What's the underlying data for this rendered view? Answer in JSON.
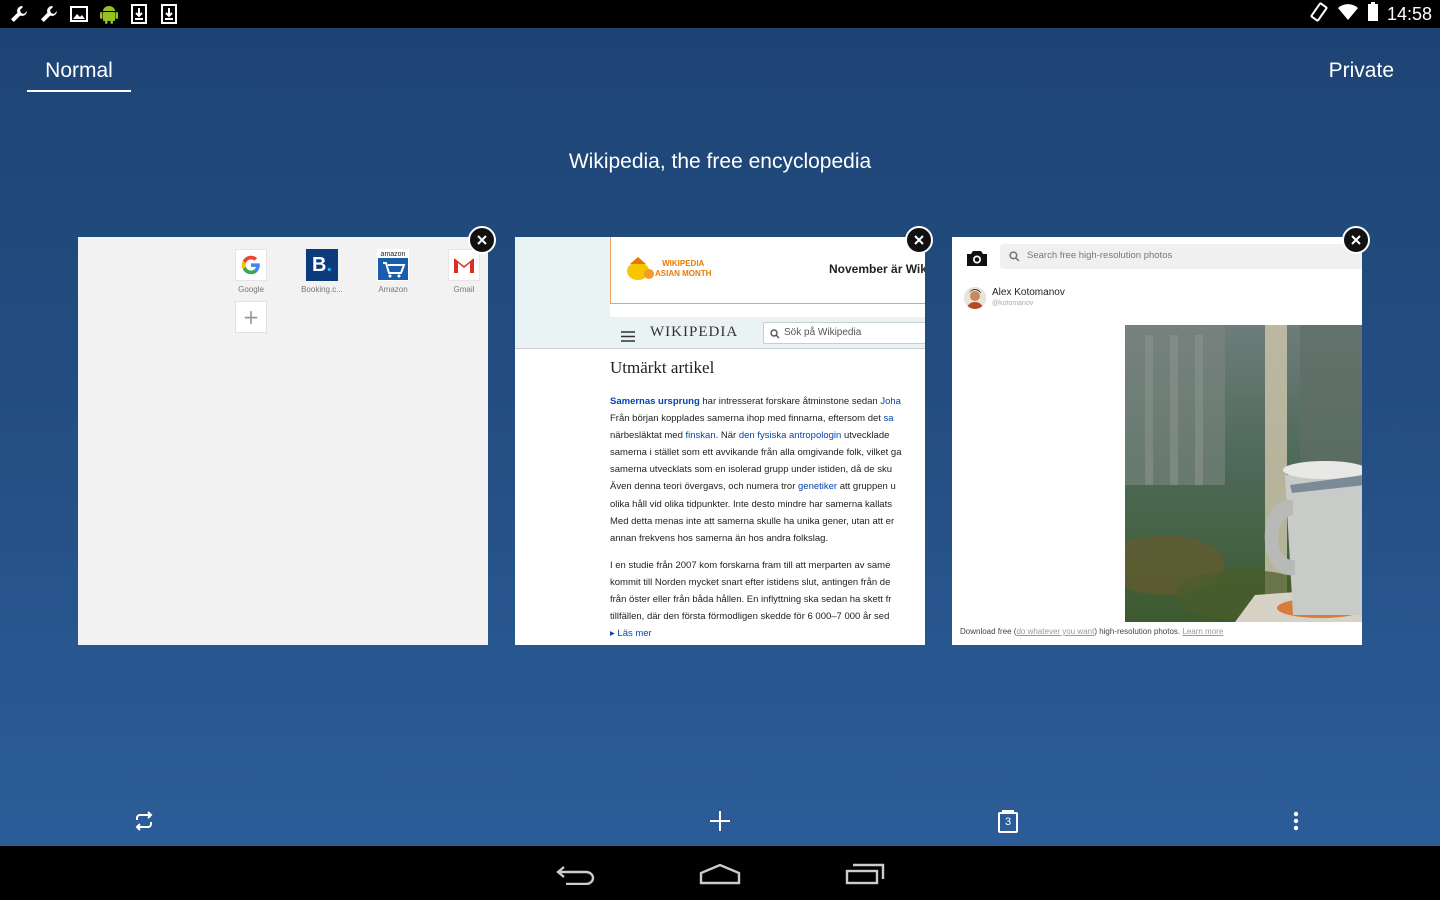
{
  "status_bar": {
    "time": "14:58",
    "left_icons": [
      "wrench-icon",
      "wrench-icon",
      "image-icon",
      "android-icon",
      "download-icon",
      "download-icon"
    ],
    "right_icons": [
      "rotate-icon",
      "wifi-icon",
      "battery-icon"
    ]
  },
  "tabs": {
    "normal": "Normal",
    "private": "Private"
  },
  "current_page_title": "Wikipedia, the free encyclopedia",
  "speed_dial": {
    "items": [
      {
        "label": "Google",
        "icon": "google-icon"
      },
      {
        "label": "Booking.c...",
        "icon": "booking-icon"
      },
      {
        "label": "Amazon",
        "icon": "amazon-icon"
      },
      {
        "label": "Gmail",
        "icon": "gmail-icon"
      }
    ],
    "add_label": "+"
  },
  "wiki_card": {
    "banner_logo_line1": "WIKIPEDIA",
    "banner_logo_line2": "ASIAN MONTH",
    "banner_text": "November är Wik",
    "logo": "WIKIPEDIA",
    "search_placeholder": "Sök på Wikipedia",
    "heading": "Utmärkt artikel",
    "para1": [
      {
        "parts": [
          {
            "t": "Samernas ursprung",
            "c": "lnk b"
          },
          {
            "t": " har intresserat forskare åtminstone sedan "
          },
          {
            "t": "Joha",
            "c": "lnk"
          }
        ]
      },
      {
        "parts": [
          {
            "t": "Från början kopplades samerna ihop med finnarna, eftersom det "
          },
          {
            "t": "sa",
            "c": "lnk"
          }
        ]
      },
      {
        "parts": [
          {
            "t": "närbesläktat med "
          },
          {
            "t": "finskan",
            "c": "lnk"
          },
          {
            "t": ". När "
          },
          {
            "t": "den fysiska antropologin",
            "c": "lnk"
          },
          {
            "t": " utvecklade"
          }
        ]
      },
      {
        "parts": [
          {
            "t": "samerna i stället som ett avvikande från alla omgivande folk, vilket ga"
          }
        ]
      },
      {
        "parts": [
          {
            "t": "samerna utvecklats som en isolerad grupp under istiden, då de sku"
          }
        ]
      },
      {
        "parts": [
          {
            "t": "Även denna teori övergavs, och numera tror "
          },
          {
            "t": "genetiker",
            "c": "lnk"
          },
          {
            "t": " att gruppen u"
          }
        ]
      },
      {
        "parts": [
          {
            "t": "olika håll vid olika tidpunkter. Inte desto mindre har samerna kallats"
          }
        ]
      },
      {
        "parts": [
          {
            "t": "Med detta menas inte att samerna skulle ha unika gener, utan att er"
          }
        ]
      },
      {
        "parts": [
          {
            "t": "annan frekvens hos samerna än hos andra folkslag."
          }
        ]
      }
    ],
    "para2": [
      "I en studie från 2007 kom forskarna fram till att merparten av same",
      "kommit till Norden mycket snart efter istidens slut, antingen från de",
      "från öster eller från båda hållen. En inflyttning ska sedan ha skett fr",
      "tillfällen, där den första förmodligen skedde för 6 000–7 000 år sed"
    ],
    "read_more": "▸ Läs mer"
  },
  "unsplash_card": {
    "search_placeholder": "Search free high-resolution photos",
    "author_name": "Alex Kotomanov",
    "author_handle": "@kotomanov",
    "footer_prefix": "Download free (",
    "footer_link": "do whatever you want",
    "footer_mid": ") high-resolution photos. ",
    "footer_learn": "Learn more"
  },
  "toolbar": {
    "tab_count": "3",
    "buttons": [
      "sync-icon",
      "plus-icon",
      "tabs-counter-icon",
      "more-vertical-icon"
    ]
  },
  "nav": [
    "back-icon",
    "home-icon",
    "recents-icon"
  ],
  "colors": {
    "background_top": "#1d4474",
    "background_bottom": "#2c5d98",
    "link": "#0645ad"
  }
}
